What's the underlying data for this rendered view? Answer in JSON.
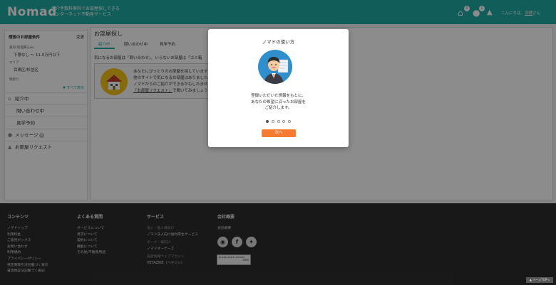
{
  "header": {
    "logo": "Nomad",
    "tagline_line1": "仲介手数料無料でお部屋探しできる",
    "tagline_line2": "インターネット不動産サービス",
    "home_badge": "0",
    "chat_badge": "1",
    "greeting_prefix": "こんにちは、",
    "user_name": "洪様",
    "greeting_suffix": "さん"
  },
  "sidebar": {
    "conditions_title": "理想のお部屋条件",
    "edit_label": "変更",
    "rent_label": "賃料(管理費込み)",
    "rent_value": "下限なし 〜 11.0万円以下",
    "area_label": "エリア",
    "area_value": "目黒区/杉並区",
    "layout_label": "間取り",
    "show_all": "▼ すべて表示",
    "nav": [
      {
        "label": "紹介中",
        "icon": "house-icon"
      },
      {
        "label": "問い合わせ中"
      },
      {
        "label": "見学予約"
      },
      {
        "label": "メッセージ",
        "badge": "0",
        "icon": "chat-icon"
      },
      {
        "label": "お部屋リクエスト",
        "icon": "bell-icon"
      }
    ]
  },
  "main": {
    "title": "お部屋探し",
    "tabs": [
      "紹介中",
      "問い合わせ中",
      "見学予約"
    ],
    "description": "気になるお部屋は「問い合わせ」、いらないお部屋は「ゴミ箱",
    "card_line1": "あなたにぴったりのお部屋を探しています",
    "card_line2": "他のサイトで気になるお部屋はありました",
    "card_line3": "ノマドからのご紹介ができるかもしれません",
    "card_link": "「お部屋リクエスト」",
    "card_line4_suffix": "で聞いてみましょう"
  },
  "modal": {
    "title": "ノマドの使い方",
    "body_line1": "登録いただいた情報をもとに、",
    "body_line2": "あなたの希望に沿ったお部屋を",
    "body_line3": "ご紹介します。",
    "next_button": "次へ",
    "page_count": 5,
    "active_page": 1
  },
  "footer": {
    "contents": {
      "heading": "コンテンツ",
      "links": [
        "ノマドトップ",
        "利用料金",
        "ご意見ボックス",
        "お問い合わせ",
        "利用規約",
        "プライバシーポリシー",
        "特定商取引法記載づく表示",
        "賃貸保証法記載づく表記"
      ]
    },
    "faq": {
      "heading": "よくある質問",
      "links": [
        "サービスについて",
        "見学について",
        "契約について",
        "機能について",
        "その他/不動産用語"
      ]
    },
    "services": {
      "heading": "サービス",
      "item1_label": "法人・個人様向け",
      "item1_link": "ノマド法人向け福利厚生サービス",
      "item2_label": "オーナー様向け",
      "item2_link": "ノマドオーナーズ",
      "item3_label": "賃貸情報ウェブマガジン",
      "item3_link": "HEYAZINE（ヘヤジン）"
    },
    "company": {
      "heading": "会社概要",
      "link": "会社概要",
      "privacy_badge_line1": "privacymark version",
      "privacy_badge_line2": "ISMS"
    },
    "page_top": "▲ ページTOPへ"
  },
  "colors": {
    "brand_teal": "#20aaa2",
    "next_orange": "#f57b33",
    "footer_bg": "#2d2d2d"
  }
}
